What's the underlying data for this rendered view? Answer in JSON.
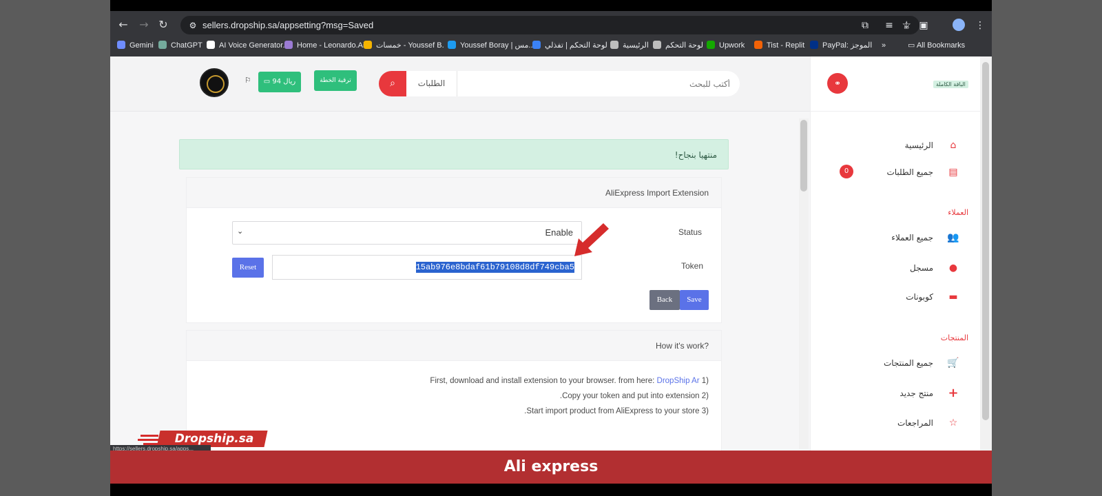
{
  "browser": {
    "url": "sellers.dropship.sa/appsetting?msg=Saved",
    "bookmarks": [
      {
        "label": "Gemini",
        "color": "#6f8dff"
      },
      {
        "label": "ChatGPT",
        "color": "#74aa9c"
      },
      {
        "label": "AI Voice Generator...",
        "color": "#ffffff"
      },
      {
        "label": "Home - Leonardo.Ai",
        "color": "#9b7bd4"
      },
      {
        "label": "خمسات - Youssef B.",
        "color": "#f5b400"
      },
      {
        "label": "Youssef Boray | مس...",
        "color": "#1d9bf0"
      },
      {
        "label": "لوحة التحكم | تفذلي",
        "color": "#3b82f6"
      },
      {
        "label": "الرئيسية",
        "color": "#bdbdbd"
      },
      {
        "label": "لوحة التحكم",
        "color": "#bdbdbd"
      },
      {
        "label": "Upwork",
        "color": "#14a800"
      },
      {
        "label": "Tist - Replit",
        "color": "#f26207"
      },
      {
        "label": "PayPal: الموجز",
        "color": "#003087"
      }
    ],
    "all_bookmarks": "All Bookmarks"
  },
  "header": {
    "search_placeholder": "أكتب للبحث",
    "search_category": "الطلبات",
    "upgrade_label": "ترقية الخطة",
    "balance_label": "94 ريال"
  },
  "alert": "منتهيا بنجاح!",
  "extension_card": {
    "title": "AliExpress Import Extension",
    "status_label": "Status",
    "status_value": "Enable",
    "token_label": "Token",
    "token_value": "15ab976e8bdaf61b79108d8df749cba5",
    "reset_label": "Reset",
    "back_label": "Back",
    "save_label": "Save"
  },
  "how_card": {
    "title": "How it's work?",
    "step1_text": "First, download and install extension to your browser. from here: ",
    "step1_link": "DropShip Ar",
    "step1_num": "(1",
    "step2": "Copy your token and put into extension.",
    "step2_num": "(2",
    "step3": "Start import product from AliExpress to your store.",
    "step3_num": "(3"
  },
  "sidebar": {
    "plan": "الباقة الكاملة",
    "home": "الرئيسية",
    "all_orders": "جميع الطلبات",
    "orders_count": "0",
    "customers_section": "العملاء",
    "all_customers": "جميع العملاء",
    "registered": "مسجل",
    "coupons": "كوبونات",
    "products_section": "المنتجات",
    "all_products": "جميع المنتجات",
    "new_product": "منتج جديد",
    "reviews": "المراجعات"
  },
  "overlay": {
    "logo": "Dropship.sa",
    "status_url": "https://sellers.dropship.sa/apps...",
    "caption": "Ali express"
  }
}
